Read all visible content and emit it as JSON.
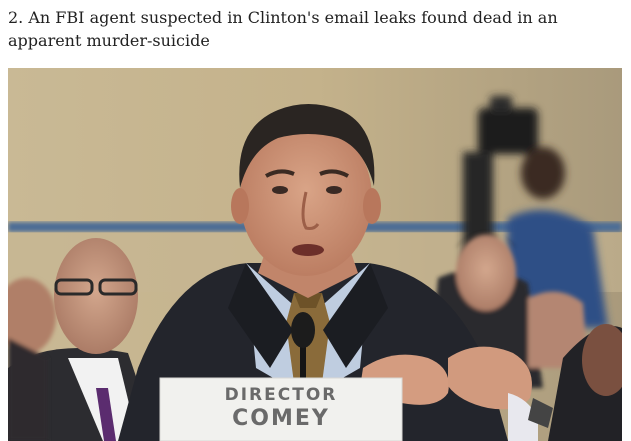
{
  "article": {
    "headline": "2. An FBI agent suspected in Clinton's email leaks found dead in an apparent murder-suicide"
  },
  "photo": {
    "placard_line1": "DIRECTOR",
    "placard_line2": "COMEY"
  }
}
